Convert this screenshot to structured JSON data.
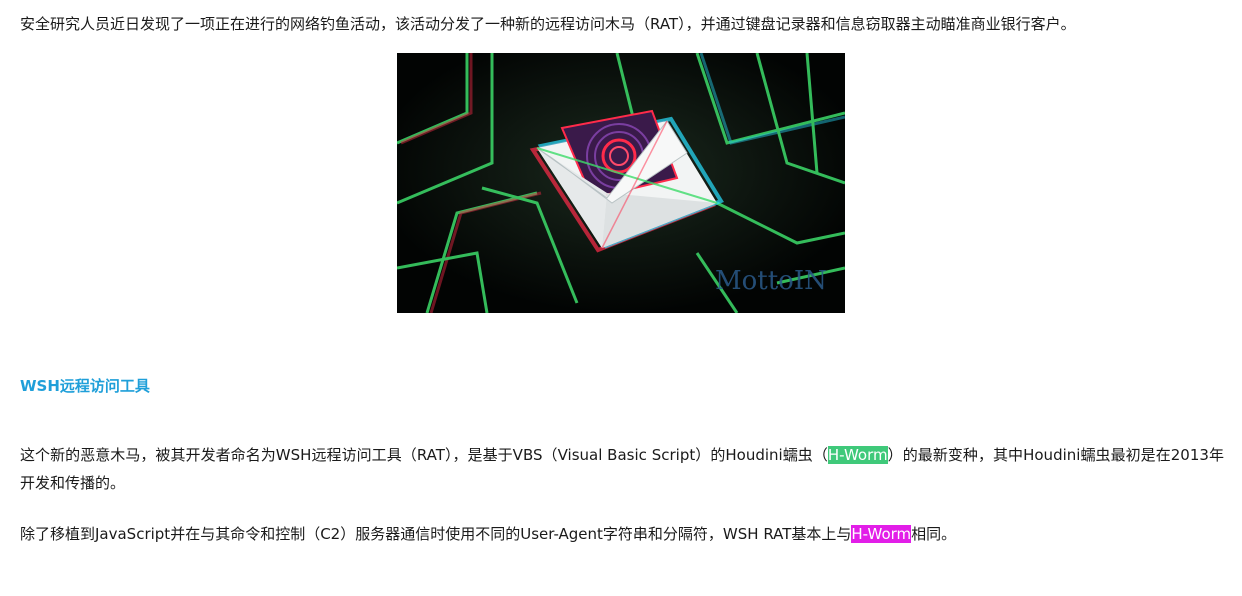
{
  "article": {
    "intro": "安全研究人员近日发现了一项正在进行的网络钓鱼活动，该活动分发了一种新的远程访问木马（RAT），并通过键盘记录器和信息窃取器主动瞄准商业银行客户。",
    "image": {
      "watermark": "MottoIN",
      "colors": {
        "background": "#050a06",
        "circuit": "#3ddc6a",
        "glitch_red": "#ff2b4a",
        "glitch_cyan": "#28e0ff"
      }
    },
    "section_heading": "WSH远程访问工具",
    "body1": {
      "before": "这个新的恶意木马，被其开发者命名为WSH远程访问工具（RAT），是基于VBS（Visual Basic Script）的Houdini蠕虫（",
      "highlight": "H-Worm",
      "after": "）的最新变种，其中Houdini蠕虫最初是在2013年开发和传播的。"
    },
    "body2": {
      "before": "除了移植到JavaScript并在与其命令和控制（C2）服务器通信时使用不同的User-Agent字符串和分隔符，WSH RAT基本上与",
      "highlight": "H-Worm",
      "after": "相同。"
    },
    "colors": {
      "heading": "#1f9fd9",
      "highlight_green": "#3fc97a",
      "highlight_magenta": "#e21ee8",
      "text": "#1a1a1a"
    }
  }
}
